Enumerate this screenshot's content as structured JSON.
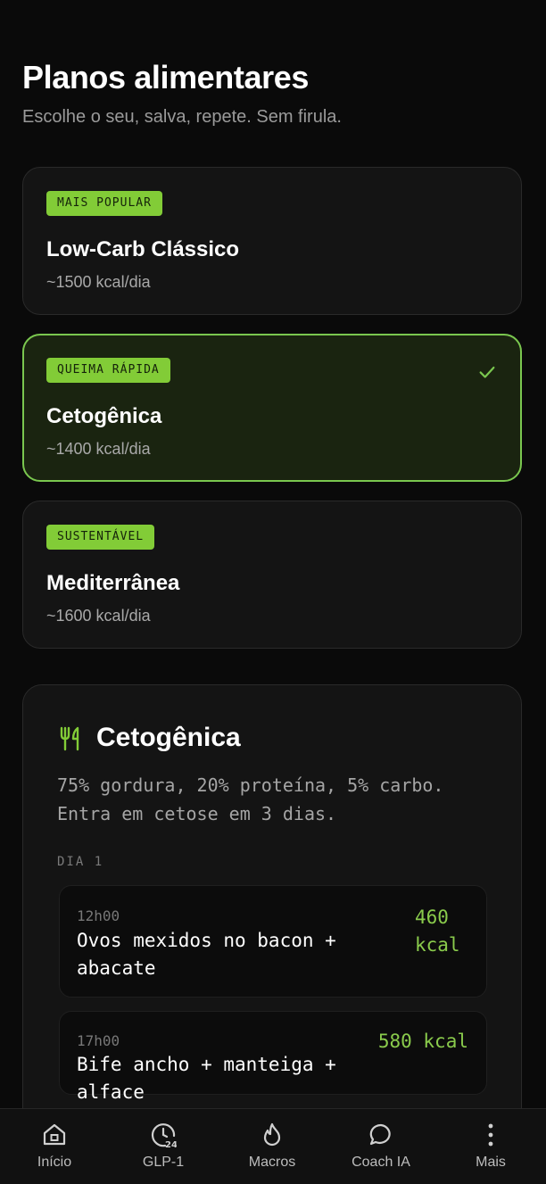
{
  "header": {
    "title": "Planos alimentares",
    "subtitle": "Escolhe o seu, salva, repete. Sem firula."
  },
  "plans": [
    {
      "badge": "MAIS POPULAR",
      "name": "Low-Carb Clássico",
      "kcal": "~1500 kcal/dia",
      "selected": false
    },
    {
      "badge": "QUEIMA RÁPIDA",
      "name": "Cetogênica",
      "kcal": "~1400 kcal/dia",
      "selected": true
    },
    {
      "badge": "SUSTENTÁVEL",
      "name": "Mediterrânea",
      "kcal": "~1600 kcal/dia",
      "selected": false
    }
  ],
  "detail": {
    "icon": "fork-knife-icon",
    "title": "Cetogênica",
    "description": "75% gordura, 20% proteína, 5% carbo. Entra em cetose em 3 dias.",
    "day_label": "DIA 1",
    "meals": [
      {
        "time": "12h00",
        "name": "Ovos mexidos no bacon + abacate",
        "kcal": "460 kcal"
      },
      {
        "time": "17h00",
        "name": "Bife ancho + manteiga + alface",
        "kcal": "580 kcal"
      }
    ]
  },
  "tabs": [
    {
      "label": "Início",
      "icon": "home-icon"
    },
    {
      "label": "GLP-1",
      "icon": "clock-24-icon"
    },
    {
      "label": "Macros",
      "icon": "flame-icon"
    },
    {
      "label": "Coach IA",
      "icon": "chat-bubble-icon"
    },
    {
      "label": "Mais",
      "icon": "more-vertical-icon"
    }
  ],
  "colors": {
    "accent": "#82cc37",
    "background": "#0a0a0a",
    "card": "#141414",
    "selected_card": "#1a2410",
    "kcal_text": "#8acb4c"
  }
}
